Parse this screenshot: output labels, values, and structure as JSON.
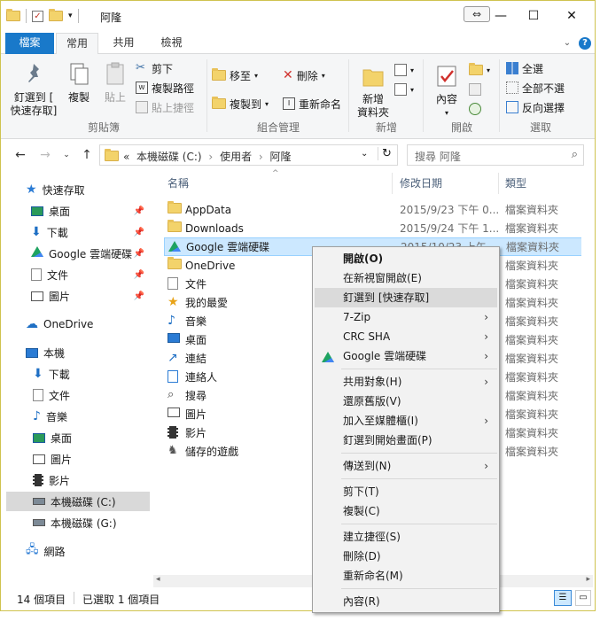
{
  "window": {
    "title": "阿隆",
    "controls": {
      "minimize": "—",
      "maximize": "☐",
      "close": "✕"
    }
  },
  "ribbon_tabs": {
    "file": "檔案",
    "home": "常用",
    "share": "共用",
    "view": "檢視"
  },
  "ribbon": {
    "clipboard": {
      "label": "剪貼簿",
      "pin_quick_access": "釘選到 [\n快速存取]",
      "copy": "複製",
      "paste": "貼上",
      "cut": "剪下",
      "copy_path": "複製路徑",
      "paste_shortcut": "貼上捷徑"
    },
    "organize": {
      "label": "組合管理",
      "move_to": "移至",
      "copy_to": "複製到",
      "delete": "刪除",
      "rename": "重新命名"
    },
    "new": {
      "label": "新增",
      "new_folder": "新增\n資料夾"
    },
    "open": {
      "label": "開啟",
      "properties": "內容"
    },
    "select": {
      "label": "選取",
      "select_all": "全選",
      "select_none": "全部不選",
      "invert": "反向選擇"
    }
  },
  "address": {
    "path_prefix": "«",
    "segments": [
      "本機磁碟 (C:)",
      "使用者",
      "阿隆"
    ],
    "separator": "›",
    "search_placeholder": "搜尋 阿隆"
  },
  "nav": {
    "quick_access": "快速存取",
    "quick_items": [
      "桌面",
      "下載",
      "Google 雲端硬碟",
      "文件",
      "圖片"
    ],
    "onedrive": "OneDrive",
    "this_pc": "本機",
    "pc_items": [
      "下載",
      "文件",
      "音樂",
      "桌面",
      "圖片",
      "影片",
      "本機磁碟 (C:)",
      "本機磁碟 (G:)"
    ],
    "network": "網路"
  },
  "columns": {
    "name": "名稱",
    "date": "修改日期",
    "type": "類型"
  },
  "files": [
    {
      "name": "AppData",
      "date": "2015/9/23 下午 0...",
      "type": "檔案資料夾"
    },
    {
      "name": "Downloads",
      "date": "2015/9/24 下午 1...",
      "type": "檔案資料夾"
    },
    {
      "name": "Google 雲端硬碟",
      "date": "2015/10/23 上午...",
      "type": "檔案資料夾"
    },
    {
      "name": "OneDrive",
      "date": "",
      "type": "檔案資料夾"
    },
    {
      "name": "文件",
      "date": "",
      "type": "檔案資料夾"
    },
    {
      "name": "我的最愛",
      "date": "",
      "type": "檔案資料夾"
    },
    {
      "name": "音樂",
      "date": "",
      "type": "檔案資料夾"
    },
    {
      "name": "桌面",
      "date": "",
      "type": "檔案資料夾"
    },
    {
      "name": "連結",
      "date": "",
      "type": "檔案資料夾"
    },
    {
      "name": "連絡人",
      "date": "",
      "type": "檔案資料夾"
    },
    {
      "name": "搜尋",
      "date": "",
      "type": "檔案資料夾"
    },
    {
      "name": "圖片",
      "date": "",
      "type": "檔案資料夾"
    },
    {
      "name": "影片",
      "date": "",
      "type": "檔案資料夾"
    },
    {
      "name": "儲存的遊戲",
      "date": "",
      "type": "檔案資料夾"
    }
  ],
  "context_menu": {
    "open": "開啟(O)",
    "open_new_window": "在新視窗開啟(E)",
    "pin_quick": "釘選到 [快速存取]",
    "zip": "7-Zip",
    "crc": "CRC SHA",
    "gdrive": "Google 雲端硬碟",
    "share_with": "共用對象(H)",
    "restore": "還原舊版(V)",
    "library": "加入至媒體櫃(I)",
    "pin_start": "釘選到開始畫面(P)",
    "send_to": "傳送到(N)",
    "cut": "剪下(T)",
    "copy": "複製(C)",
    "create_shortcut": "建立捷徑(S)",
    "delete": "刪除(D)",
    "rename": "重新命名(M)",
    "properties": "內容(R)"
  },
  "status": {
    "count": "14 個項目",
    "selected": "已選取 1 個項目"
  }
}
